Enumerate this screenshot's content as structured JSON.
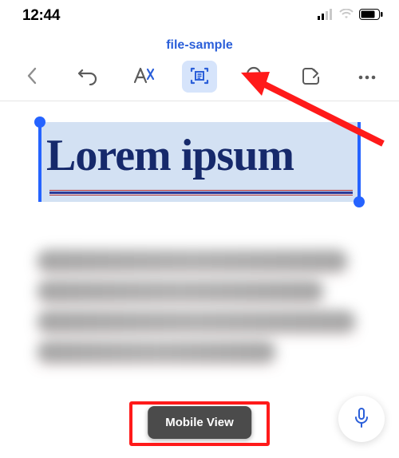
{
  "status": {
    "time": "12:44"
  },
  "header": {
    "doc_title": "file-sample"
  },
  "selection": {
    "text": "Lorem ipsum"
  },
  "pill": {
    "label": "Mobile View"
  },
  "icons": {
    "back": "chevron-left-icon",
    "undo": "undo-icon",
    "style": "text-style-icon",
    "reflow": "mobile-view-icon",
    "search": "search-icon",
    "share": "share-icon",
    "more": "more-icon",
    "mic": "mic-icon",
    "signal": "cellular-icon",
    "wifi": "wifi-icon",
    "battery": "battery-icon"
  },
  "colors": {
    "accent_blue": "#2b5fd9",
    "selection_bg": "#d3e1f3",
    "highlight_red": "#ff1a1a"
  }
}
